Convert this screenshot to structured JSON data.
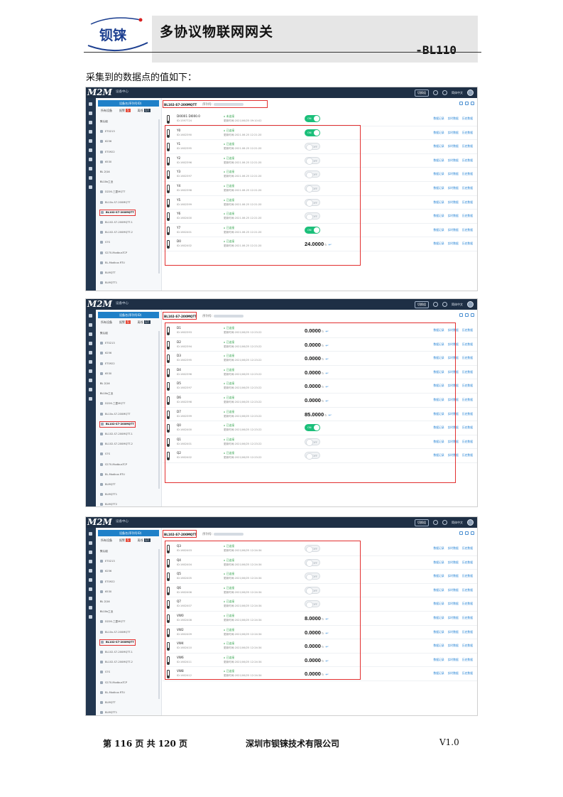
{
  "header": {
    "logo_text": "钡铼",
    "title": "多协议物联网网关",
    "model": "-BL110"
  },
  "intro": "采集到的数据点的值如下：",
  "app": {
    "brand": "M2M",
    "crumb": "设备中心",
    "top_button": "切换组",
    "language": "简体中文",
    "search_label": "设备名(序列号ID)",
    "tabs": [
      {
        "label": "所有设备"
      },
      {
        "label": "报警",
        "badge": "5"
      },
      {
        "label": "离线",
        "badge": "17"
      }
    ],
    "serial_label": "序列号:",
    "action_labels": [
      "数据记录",
      "实时数据",
      "历史数据"
    ],
    "status_label": "已连接",
    "status_offline_label": "未连接",
    "time_prefix": "更新时间:"
  },
  "tree": [
    {
      "label": "默认组",
      "kind": "group"
    },
    {
      "label": "ET0213",
      "kind": "item"
    },
    {
      "label": "6256",
      "kind": "item"
    },
    {
      "label": "ET0922",
      "kind": "item"
    },
    {
      "label": "6530",
      "kind": "item"
    },
    {
      "label": "BL",
      "kind": "group",
      "count": "2/14"
    },
    {
      "label": "BL10x工业",
      "kind": "group"
    },
    {
      "label": "D226-三菱MQTT",
      "kind": "item"
    },
    {
      "label": "BL10x-S7-200MQTT",
      "kind": "item"
    },
    {
      "label": "BL102-S7-200MQTT",
      "kind": "item",
      "selected": true
    },
    {
      "label": "BL102-S7-200MQTT-1",
      "kind": "item"
    },
    {
      "label": "BL102-S7-200MQTT-2",
      "kind": "item"
    },
    {
      "label": "S7S",
      "kind": "item"
    },
    {
      "label": "S270-ModbusTCP",
      "kind": "item"
    },
    {
      "label": "BL-Modbus RTU",
      "kind": "item"
    },
    {
      "label": "BLMQTT",
      "kind": "item"
    },
    {
      "label": "BLMQTT1",
      "kind": "item"
    },
    {
      "label": "BLMQTT2",
      "kind": "item"
    }
  ],
  "panels": [
    {
      "device": "BL102-S7-200MQTT",
      "rows": [
        {
          "name": "DI0001 DI000.0",
          "id": "ID:1597724",
          "status": "未连接",
          "time": "更新时间:2021/06/25 09:10:02",
          "toggle": "on"
        },
        {
          "name": "Y0",
          "id": "ID:1602390",
          "status": "已连接",
          "time": "更新时间:2021.06.25 12:21:20",
          "toggle": "on"
        },
        {
          "name": "Y1",
          "id": "ID:1602395",
          "status": "已连接",
          "time": "更新时间:2021.06.25 12:21:20",
          "toggle": "off"
        },
        {
          "name": "Y2",
          "id": "ID:1602396",
          "status": "已连接",
          "time": "更新时间:2021.06.25 12:21:20",
          "toggle": "off"
        },
        {
          "name": "Y3",
          "id": "ID:1602397",
          "status": "已连接",
          "time": "更新时间:2021.06.25 12:21:20",
          "toggle": "off"
        },
        {
          "name": "Y4",
          "id": "ID:1602398",
          "status": "已连接",
          "time": "更新时间:2021.06.25 12:21:20",
          "toggle": "off"
        },
        {
          "name": "Y5",
          "id": "ID:1602399",
          "status": "已连接",
          "time": "更新时间:2021.06.25 12:21:20",
          "toggle": "off"
        },
        {
          "name": "Y6",
          "id": "ID:1602400",
          "status": "已连接",
          "time": "更新时间:2021.06.25 12:21:20",
          "toggle": "off"
        },
        {
          "name": "Y7",
          "id": "ID:1602401",
          "status": "已连接",
          "time": "更新时间:2021.06.25 12:21:20",
          "toggle": "on"
        },
        {
          "name": "D0",
          "id": "ID:1602402",
          "status": "已连接",
          "time": "更新时间:2021.06.25 12:21:20",
          "value": "24.0000"
        }
      ]
    },
    {
      "device": "BL102-S7-200MQTT",
      "rows": [
        {
          "name": "D1",
          "id": "ID:1602393",
          "status": "已连接",
          "time": "更新时间:2021/06/25 12:23:22",
          "value": "0.0000"
        },
        {
          "name": "D2",
          "id": "ID:1602394",
          "status": "已连接",
          "time": "更新时间:2021/06/25 12:23:22",
          "value": "0.0000"
        },
        {
          "name": "D3",
          "id": "ID:1602395",
          "status": "已连接",
          "time": "更新时间:2021/06/25 12:23:22",
          "value": "0.0000"
        },
        {
          "name": "D4",
          "id": "ID:1602396",
          "status": "已连接",
          "time": "更新时间:2021/06/25 12:23:22",
          "value": "0.0000"
        },
        {
          "name": "D5",
          "id": "ID:1602397",
          "status": "已连接",
          "time": "更新时间:2021/06/25 12:23:22",
          "value": "0.0000"
        },
        {
          "name": "D6",
          "id": "ID:1602398",
          "status": "已连接",
          "time": "更新时间:2021/06/25 12:23:22",
          "value": "0.0000"
        },
        {
          "name": "D7",
          "id": "ID:1602399",
          "status": "已连接",
          "time": "更新时间:2021/06/25 12:23:22",
          "value": "85.0000"
        },
        {
          "name": "Q0",
          "id": "ID:1602400",
          "status": "已连接",
          "time": "更新时间:2021/06/25 12:23:22",
          "toggle": "on"
        },
        {
          "name": "Q1",
          "id": "ID:1602401",
          "status": "已连接",
          "time": "更新时间:2021/06/25 12:23:22",
          "toggle": "off"
        },
        {
          "name": "Q2",
          "id": "ID:1602402",
          "status": "已连接",
          "time": "更新时间:2021/06/25 12:23:22",
          "toggle": "off"
        }
      ]
    },
    {
      "device": "BL102-S7-200MQTT",
      "rows": [
        {
          "name": "Q3",
          "id": "ID:1602403",
          "status": "已连接",
          "time": "更新时间:2021/06/25 12:24:34",
          "toggle": "off"
        },
        {
          "name": "Q4",
          "id": "ID:1602404",
          "status": "已连接",
          "time": "更新时间:2021/06/25 12:24:34",
          "toggle": "off"
        },
        {
          "name": "Q5",
          "id": "ID:1602405",
          "status": "已连接",
          "time": "更新时间:2021/06/25 12:24:34",
          "toggle": "off"
        },
        {
          "name": "Q6",
          "id": "ID:1602406",
          "status": "已连接",
          "time": "更新时间:2021/06/25 12:24:34",
          "toggle": "off"
        },
        {
          "name": "Q7",
          "id": "ID:1602407",
          "status": "已连接",
          "time": "更新时间:2021/06/25 12:24:34",
          "toggle": "off"
        },
        {
          "name": "VW0",
          "id": "ID:1602408",
          "status": "已连接",
          "time": "更新时间:2021/06/25 12:24:34",
          "value": "8.0000"
        },
        {
          "name": "VW2",
          "id": "ID:1602409",
          "status": "已连接",
          "time": "更新时间:2021/06/25 12:24:34",
          "value": "0.0000"
        },
        {
          "name": "VW4",
          "id": "ID:1602410",
          "status": "已连接",
          "time": "更新时间:2021/06/25 12:24:34",
          "value": "0.0000"
        },
        {
          "name": "VW6",
          "id": "ID:1602411",
          "status": "已连接",
          "time": "更新时间:2021/06/25 12:24:34",
          "value": "0.0000"
        },
        {
          "name": "VW8",
          "id": "ID:1602412",
          "status": "已连接",
          "time": "更新时间:2021/06/25 12:24:34",
          "value": "0.0000"
        }
      ]
    }
  ],
  "toggle_labels": {
    "on": "ON",
    "off": "OFF"
  },
  "footer": {
    "page_text": "第 116 页 共 120 页",
    "company": "深圳市钡铼技术有限公司",
    "version": "V1.0"
  },
  "colors": {
    "topbar": "#1e2f45",
    "accent": "#1f80c8",
    "highlight": "#e23030",
    "toggle_on": "#1bbf7a"
  }
}
